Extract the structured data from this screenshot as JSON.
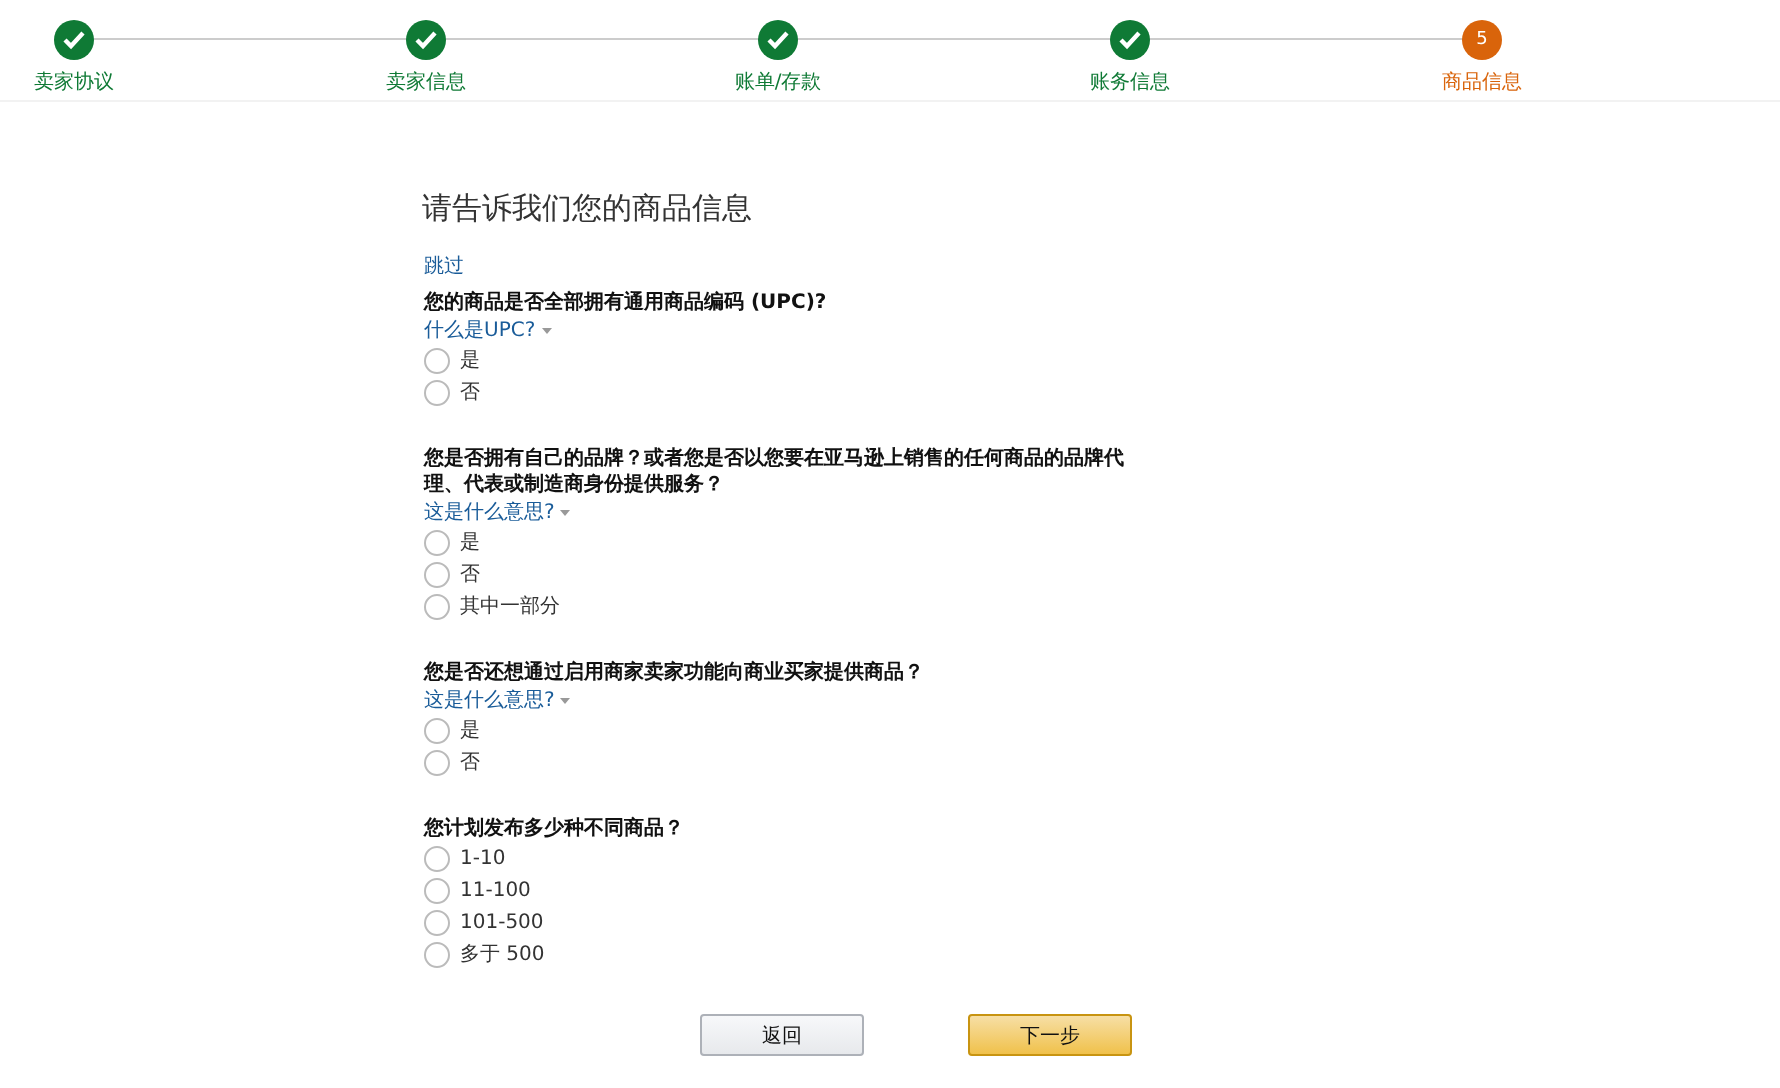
{
  "steps": [
    {
      "label": "卖家协议",
      "completed": true
    },
    {
      "label": "卖家信息",
      "completed": true
    },
    {
      "label": "账单/存款",
      "completed": true
    },
    {
      "label": "账务信息",
      "completed": true
    },
    {
      "label": "商品信息",
      "completed": false,
      "number": "5"
    }
  ],
  "title": "请告诉我们您的商品信息",
  "skip_link": "跳过",
  "questions": [
    {
      "text": "您的商品是否全部拥有通用商品编码 (UPC)?",
      "help": "什么是UPC?",
      "options": [
        {
          "label": "是",
          "selected": false
        },
        {
          "label": "否",
          "selected": false
        }
      ]
    },
    {
      "text": "您是否拥有自己的品牌？或者您是否以您要在亚马逊上销售的任何商品的品牌代理、代表或制造商身份提供服务？",
      "help": "这是什么意思?",
      "options": [
        {
          "label": "是",
          "selected": false
        },
        {
          "label": "否",
          "selected": false
        },
        {
          "label": "其中一部分",
          "selected": false
        }
      ]
    },
    {
      "text": "您是否还想通过启用商家卖家功能向商业买家提供商品？",
      "help": "这是什么意思?",
      "options": [
        {
          "label": "是",
          "selected": false
        },
        {
          "label": "否",
          "selected": false
        }
      ]
    },
    {
      "text": "您计划发布多少种不同商品？",
      "options": [
        {
          "label": "1-10",
          "selected": false
        },
        {
          "label": "11-100",
          "selected": false
        },
        {
          "label": "101-500",
          "selected": false
        },
        {
          "label": "多于 500",
          "selected": false
        }
      ]
    }
  ],
  "buttons": {
    "back": "返回",
    "next": "下一步"
  }
}
